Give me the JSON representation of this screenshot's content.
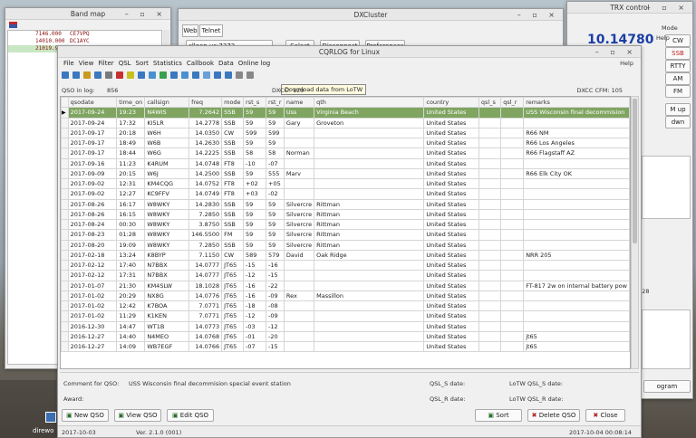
{
  "band_map": {
    "title": "Band map",
    "spots": [
      {
        "freq": "7146.000",
        "call": "CE7VPQ",
        "hl": false
      },
      {
        "freq": "14010.000",
        "call": "DC1AYC",
        "hl": false
      },
      {
        "freq": "21019.900",
        "call": "CE3...",
        "hl": true
      }
    ]
  },
  "dx": {
    "title": "DXCluster",
    "tabs": [
      "Web",
      "Telnet"
    ],
    "server": "clloop.us:7373",
    "buttons": [
      "Select",
      "Disconnect",
      "Preferences"
    ]
  },
  "trx": {
    "title": "TRX control",
    "mode_label": "Mode",
    "freq": "10.14780",
    "modes": [
      "CW",
      "SSB",
      "RTTY",
      "AM",
      "FM"
    ],
    "help": "Help",
    "mem": "M up",
    "mem2": "dwn",
    "time": ":28",
    "program": "ogram"
  },
  "main": {
    "title": "CQRLOG for Linux",
    "menu": [
      "File",
      "View",
      "Filter",
      "QSL",
      "Sort",
      "Statistics",
      "Callbook",
      "Data",
      "Online log"
    ],
    "help": "Help",
    "tooltip": "Download data from LoTW",
    "qso_in_log_label": "QSO in log:",
    "qso_in_log": "856",
    "dxcc_label": "DXCC:",
    "dxcc": "129",
    "dxcc_cfm": "DXCC CFM:  105",
    "columns": [
      "qsodate",
      "time_on",
      "callsign",
      "freq",
      "mode",
      "rst_s",
      "rst_r",
      "name",
      "qth",
      "country",
      "qsl_s",
      "qsl_r",
      "remarks"
    ],
    "rows": [
      [
        "2017-09-24",
        "19:23",
        "N4WIS",
        "7.2642",
        "SSB",
        "59",
        "59",
        "Uss",
        "Virginia Beach",
        "United States",
        "",
        "",
        "USS Wisconsin final decommision"
      ],
      [
        "2017-09-24",
        "17:32",
        "KI5LR",
        "14.2778",
        "SSB",
        "59",
        "59",
        "Gary",
        "Groveton",
        "United States",
        "",
        "",
        ""
      ],
      [
        "2017-09-17",
        "20:18",
        "W6H",
        "14.0350",
        "CW",
        "599",
        "599",
        "",
        "",
        "United States",
        "",
        "",
        "R66 NM"
      ],
      [
        "2017-09-17",
        "18:49",
        "W6B",
        "14.2630",
        "SSB",
        "59",
        "59",
        "",
        "",
        "United States",
        "",
        "",
        "R66 Los Angeles"
      ],
      [
        "2017-09-17",
        "18:44",
        "W6G",
        "14.2225",
        "SSB",
        "58",
        "58",
        "Norman",
        "",
        "United States",
        "",
        "",
        "R66 Flagstaff AZ"
      ],
      [
        "2017-09-16",
        "11:23",
        "K4RUM",
        "14.0748",
        "FT8",
        "-10",
        "-07",
        "",
        "",
        "United States",
        "",
        "",
        ""
      ],
      [
        "2017-09-09",
        "20:15",
        "W6J",
        "14.2500",
        "SSB",
        "59",
        "555",
        "Marv",
        "",
        "United States",
        "",
        "",
        "R66 Elk City OK"
      ],
      [
        "2017-09-02",
        "12:31",
        "KM4CQG",
        "14.0752",
        "FT8",
        "+02",
        "+05",
        "",
        "",
        "United States",
        "",
        "",
        ""
      ],
      [
        "2017-09-02",
        "12:27",
        "KC9FFV",
        "14.0749",
        "FT8",
        "+03",
        "-02",
        "",
        "",
        "United States",
        "",
        "",
        ""
      ],
      [
        "2017-08-26",
        "16:17",
        "W8WKY",
        "14.2830",
        "SSB",
        "59",
        "59",
        "Silvercre",
        "Rittman",
        "United States",
        "",
        "",
        ""
      ],
      [
        "2017-08-26",
        "16:15",
        "W8WKY",
        "7.2850",
        "SSB",
        "59",
        "59",
        "Silvercre",
        "Rittman",
        "United States",
        "",
        "",
        ""
      ],
      [
        "2017-08-24",
        "00:30",
        "W8WKY",
        "3.8750",
        "SSB",
        "59",
        "59",
        "Silvercre",
        "Rittman",
        "United States",
        "",
        "",
        ""
      ],
      [
        "2017-08-23",
        "01:28",
        "W8WKY",
        "146.5500",
        "FM",
        "59",
        "59",
        "Silvercre",
        "Rittman",
        "United States",
        "",
        "",
        ""
      ],
      [
        "2017-08-20",
        "19:09",
        "W8WKY",
        "7.2850",
        "SSB",
        "59",
        "59",
        "Silvercre",
        "Rittman",
        "United States",
        "",
        "",
        ""
      ],
      [
        "2017-02-18",
        "13:24",
        "K8BYP",
        "7.1150",
        "CW",
        "589",
        "579",
        "David",
        "Oak Ridge",
        "United States",
        "",
        "",
        "NRR 205"
      ],
      [
        "2017-02-12",
        "17:40",
        "N7BBX",
        "14.0777",
        "JT65",
        "-15",
        "-16",
        "",
        "",
        "United States",
        "",
        "",
        ""
      ],
      [
        "2017-02-12",
        "17:31",
        "N7BBX",
        "14.0777",
        "JT65",
        "-12",
        "-15",
        "",
        "",
        "United States",
        "",
        "",
        ""
      ],
      [
        "2017-01-07",
        "21:30",
        "KM4SLW",
        "18.1028",
        "JT65",
        "-16",
        "-22",
        "",
        "",
        "United States",
        "",
        "",
        "FT-817 2w on internal battery pow"
      ],
      [
        "2017-01-02",
        "20:29",
        "NX8G",
        "14.0776",
        "JT65",
        "-16",
        "-09",
        "Rex",
        "Massillon",
        "United States",
        "",
        "",
        ""
      ],
      [
        "2017-01-02",
        "12:42",
        "K7BOA",
        "7.0771",
        "JT65",
        "-18",
        "-08",
        "",
        "",
        "United States",
        "",
        "",
        ""
      ],
      [
        "2017-01-02",
        "11:29",
        "K1KEN",
        "7.0771",
        "JT65",
        "-12",
        "-09",
        "",
        "",
        "United States",
        "",
        "",
        ""
      ],
      [
        "2016-12-30",
        "14:47",
        "WT1B",
        "14.0773",
        "JT65",
        "-03",
        "-12",
        "",
        "",
        "United States",
        "",
        "",
        ""
      ],
      [
        "2016-12-27",
        "14:40",
        "N4MEO",
        "14.0768",
        "JT65",
        "-01",
        "-20",
        "",
        "",
        "United States",
        "",
        "",
        "jt65"
      ],
      [
        "2016-12-27",
        "14:09",
        "WB7EGF",
        "14.0766",
        "JT65",
        "-07",
        "-15",
        "",
        "",
        "United States",
        "",
        "",
        "jt65"
      ]
    ],
    "comment_label": "Comment for QSO:",
    "comment": "USS Wisconsin final decommision special event station",
    "award_label": "Award:",
    "qsl_s_date": "QSL_S date:",
    "qsl_r_date": "QSL_R date:",
    "lotw_s": "LoTW QSL_S date:",
    "lotw_r": "LoTW QSL_R date:",
    "btn_new": "New QSO",
    "btn_view": "View QSO",
    "btn_edit": "Edit QSO",
    "btn_sort": "Sort",
    "btn_delete": "Delete QSO",
    "btn_close": "Close",
    "status_date": "2017-10-03",
    "version": "Ver. 2.1.0 (001)",
    "status_right": "2017-10-04  00:08:14"
  },
  "desktop": {
    "label": "direwo"
  }
}
